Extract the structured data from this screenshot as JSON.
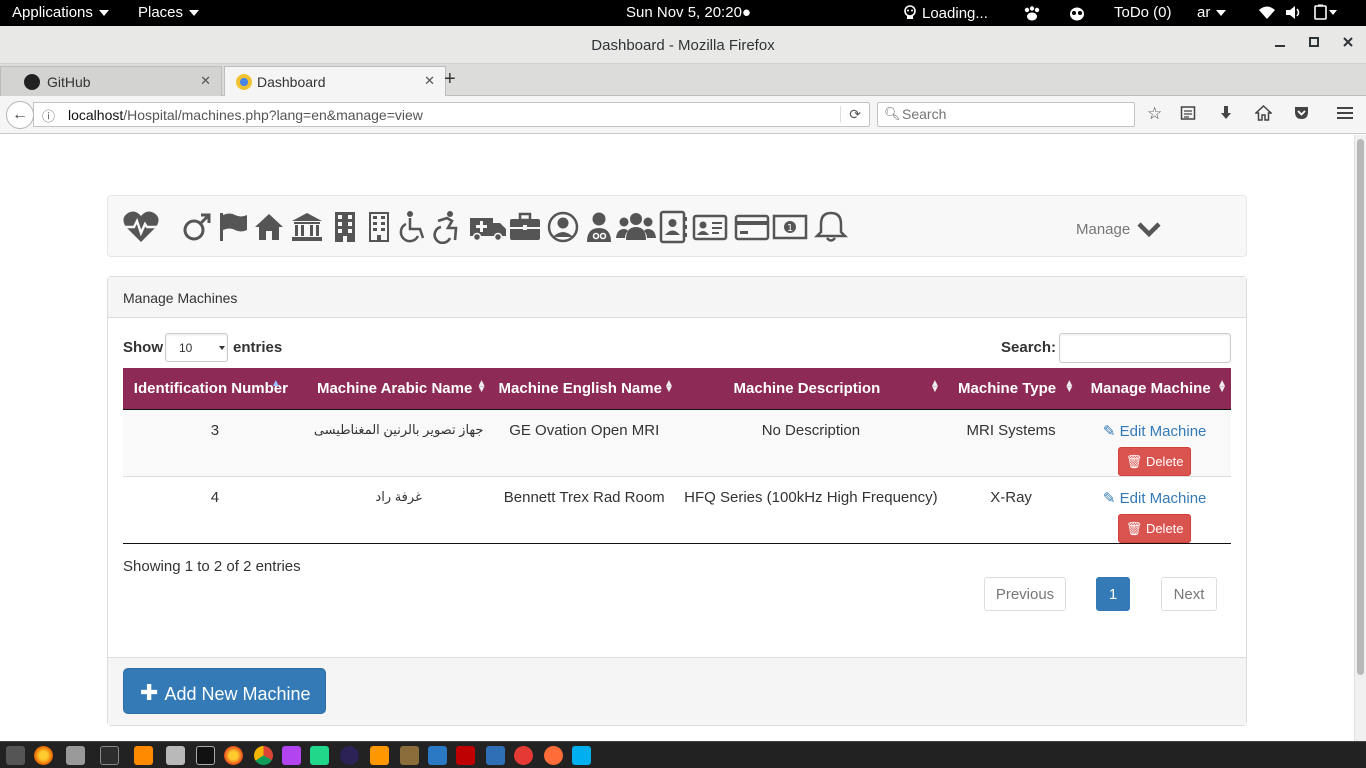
{
  "system_bar": {
    "applications": "Applications",
    "places": "Places",
    "clock": "Sun Nov  5, 20:20●",
    "loading": "Loading...",
    "todo": "ToDo (0)",
    "lang": "ar"
  },
  "window": {
    "title": "Dashboard - Mozilla Firefox"
  },
  "browser": {
    "tabs": [
      {
        "label": "GitHub"
      },
      {
        "label": "Dashboard"
      }
    ],
    "url_host": "localhost",
    "url_path": "/Hospital/machines.php?lang=en&manage=view",
    "search_placeholder": "Search"
  },
  "appnav": {
    "icons": [
      "heartbeat-icon",
      "mars-icon",
      "flag-icon",
      "home-icon",
      "bank-icon",
      "building-icon",
      "building-outline-icon",
      "wheelchair-icon",
      "accessible-icon",
      "ambulance-icon",
      "briefcase-icon",
      "user-circle-icon",
      "user-md-icon",
      "users-icon",
      "address-book-icon",
      "id-card-icon",
      "credit-card-icon",
      "money-icon",
      "bell-icon"
    ],
    "manage_label": "Manage"
  },
  "panel": {
    "heading": "Manage Machines",
    "show_label": "Show",
    "page_size": "10",
    "entries_label": "entries",
    "search_label": "Search:",
    "columns": [
      "Identification Number",
      "Machine Arabic Name",
      "Machine English Name",
      "Machine Description",
      "Machine Type",
      "Manage Machine"
    ],
    "rows": [
      {
        "id": "3",
        "arabic": "جهاز تصوير بالرنين المغناطيسى",
        "english": "GE Ovation Open MRI",
        "description": "No Description",
        "type": "MRI Systems"
      },
      {
        "id": "4",
        "arabic": "غرفة راد",
        "english": "Bennett Trex Rad Room",
        "description": "HFQ Series (100kHz High Frequency)",
        "type": "X-Ray"
      }
    ],
    "edit_label": "Edit Machine",
    "delete_label": "Delete",
    "info_text": "Showing 1 to 2 of 2 entries",
    "pager": {
      "previous": "Previous",
      "current": "1",
      "next": "Next"
    },
    "add_button": "Add New Machine"
  },
  "colors": {
    "table_header": "#8d2b56",
    "primary": "#337ab7",
    "danger": "#d9534f"
  },
  "taskbar": {
    "icons": [
      "show-desktop-icon",
      "firefox-icon",
      "files-icon",
      "terminal-icon",
      "sublime-icon",
      "archive-icon",
      "terminal-dark-icon",
      "firefox-dev-icon",
      "chrome-icon",
      "phpstorm-icon",
      "pycharm-icon",
      "eclipse-icon",
      "sublime-alt-icon",
      "gimp-icon",
      "vscode-icon",
      "filezilla-icon",
      "thunderbird-icon",
      "git-icon",
      "postman-icon",
      "skype-icon"
    ]
  }
}
